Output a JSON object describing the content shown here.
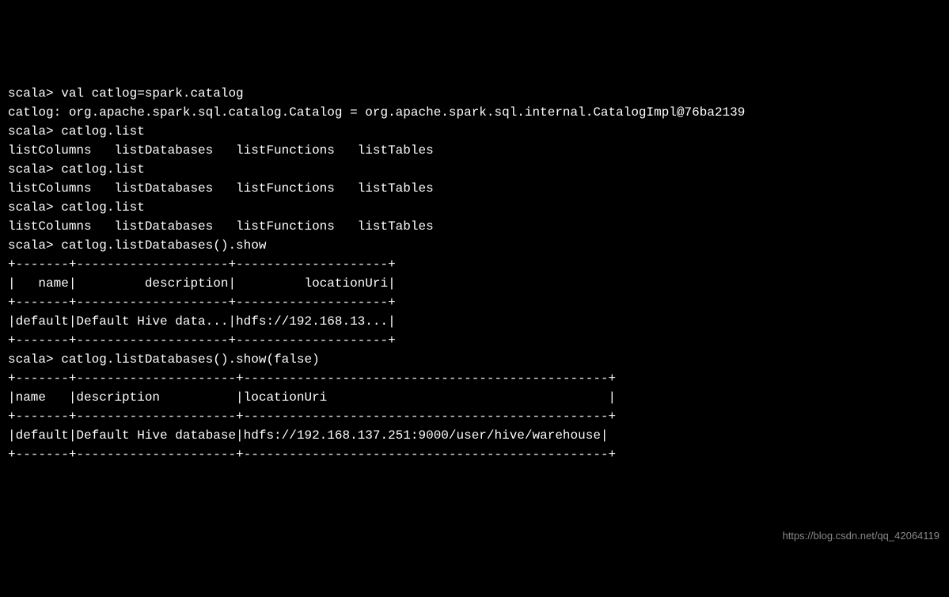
{
  "terminal": {
    "lines": [
      "scala> val catlog=spark.catalog",
      "catlog: org.apache.spark.sql.catalog.Catalog = org.apache.spark.sql.internal.CatalogImpl@76ba2139",
      "",
      "scala> catlog.list",
      "listColumns   listDatabases   listFunctions   listTables",
      "",
      "scala> catlog.list",
      "listColumns   listDatabases   listFunctions   listTables",
      "",
      "scala> catlog.list",
      "listColumns   listDatabases   listFunctions   listTables",
      "",
      "scala> catlog.listDatabases().show",
      "+-------+--------------------+--------------------+",
      "|   name|         description|         locationUri|",
      "+-------+--------------------+--------------------+",
      "|default|Default Hive data...|hdfs://192.168.13...|",
      "+-------+--------------------+--------------------+",
      "",
      "",
      "scala> catlog.listDatabases().show(false)",
      "+-------+---------------------+------------------------------------------------+",
      "|name   |description          |locationUri                                     |",
      "+-------+---------------------+------------------------------------------------+",
      "|default|Default Hive database|hdfs://192.168.137.251:9000/user/hive/warehouse|",
      "+-------+---------------------+------------------------------------------------+"
    ]
  },
  "watermark": "https://blog.csdn.net/qq_42064119"
}
